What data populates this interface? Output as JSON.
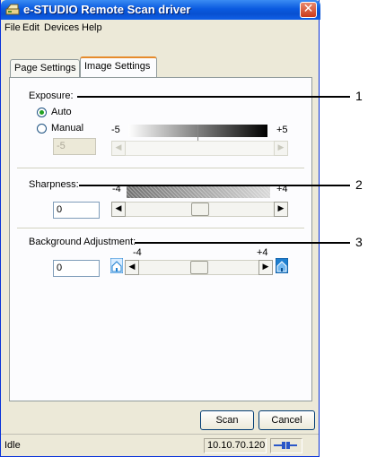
{
  "window": {
    "title": "e-STUDIO Remote Scan driver",
    "close_glyph": "✕"
  },
  "menu": [
    "File",
    "Edit",
    "Devices",
    "Help"
  ],
  "tabs": [
    {
      "label": "Page Settings",
      "active": false
    },
    {
      "label": "Image Settings",
      "active": true
    }
  ],
  "exposure": {
    "label": "Exposure:",
    "options": [
      {
        "label": "Auto",
        "checked": true
      },
      {
        "label": "Manual",
        "checked": false
      }
    ],
    "value": "-5",
    "min_label": "-5",
    "max_label": "+5"
  },
  "sharpness": {
    "label": "Sharpness:",
    "value": "0",
    "min_label": "-4",
    "max_label": "+4"
  },
  "background": {
    "label": "Background Adjustment:",
    "value": "0",
    "min_label": "-4",
    "max_label": "+4"
  },
  "buttons": {
    "scan": "Scan",
    "cancel": "Cancel"
  },
  "status": {
    "text": "Idle",
    "ip": "10.10.70.120",
    "connection_icon": "connection-icon"
  },
  "callouts": [
    "1",
    "2",
    "3"
  ],
  "colors": {
    "titlebar": "#0a5ae0",
    "active_tab_accent": "#e68b2c",
    "house_icon": "#1e7fd0"
  },
  "icons": {
    "app": "scanner-app-icon",
    "scroll_left": "◀",
    "scroll_right": "▶"
  }
}
